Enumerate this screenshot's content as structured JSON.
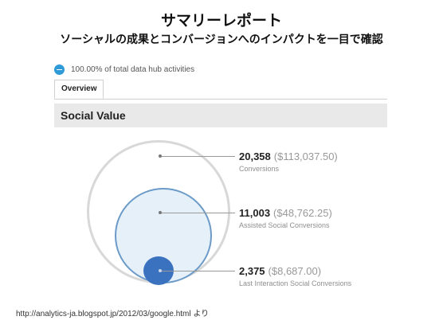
{
  "slide": {
    "title": "サマリーレポート",
    "subtitle": "ソーシャルの成果とコンバージョンへのインパクトを一目で確認",
    "source_url": "http://analytics-ja.blogspot.jp/2012/03/google.html より"
  },
  "report": {
    "segment_text": "100.00% of total data hub activities",
    "tabs": [
      {
        "label": "Overview",
        "active": true
      }
    ],
    "section_title": "Social Value",
    "metrics": [
      {
        "value": "20,358",
        "money": "($113,037.50)",
        "label": "Conversions"
      },
      {
        "value": "11,003",
        "money": "($48,762.25)",
        "label": "Assisted Social Conversions"
      },
      {
        "value": "2,375",
        "money": "($8,687.00)",
        "label": "Last Interaction Social Conversions"
      }
    ]
  },
  "colors": {
    "segment_dot": "#2e9ad8",
    "outer_ring": "#d8d8d8",
    "mid_fill": "#e6f0f8",
    "mid_ring": "#6c9bc9",
    "inner_fill": "#3b72bf"
  }
}
